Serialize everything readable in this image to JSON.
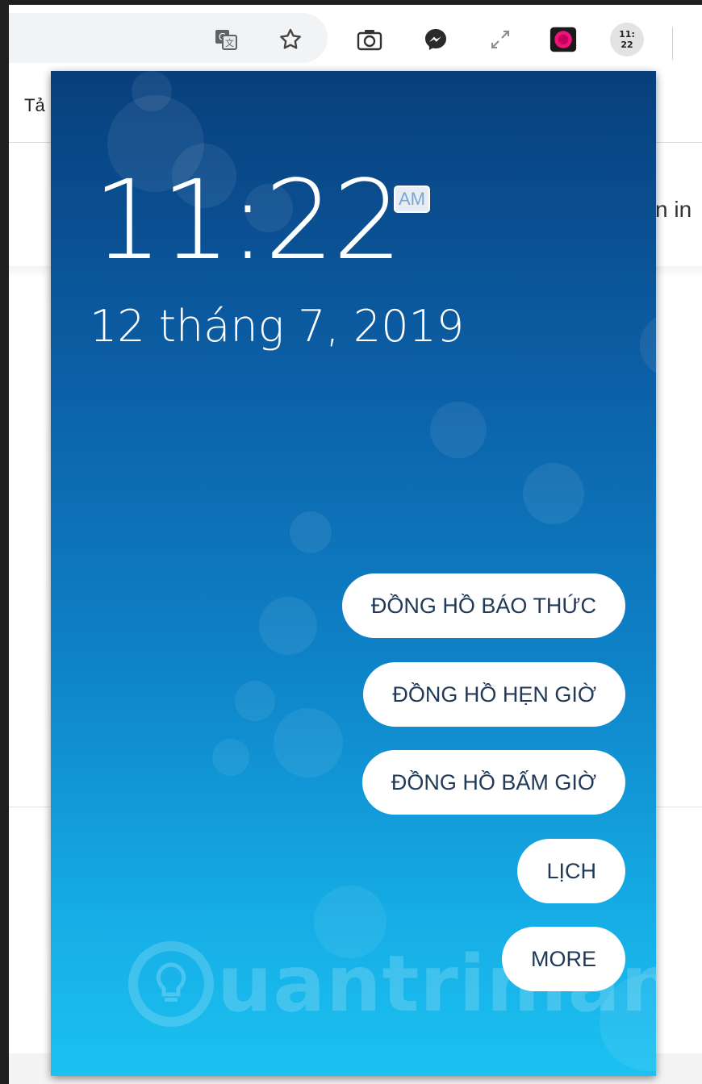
{
  "browser": {
    "toolbar_icons": [
      "translate-icon",
      "star-icon",
      "camera-icon",
      "messenger-icon",
      "expand-icon",
      "record-icon"
    ],
    "clock_extension_label": "11:\n22"
  },
  "page": {
    "left_text": "Tả",
    "right_text": "n in"
  },
  "popup": {
    "time": "11:22",
    "ampm": "AM",
    "date": "12 tháng 7, 2019",
    "buttons": [
      {
        "label": "ĐỒNG HỒ BÁO THỨC"
      },
      {
        "label": "ĐỒNG HỒ HẸN GIỜ"
      },
      {
        "label": "ĐỒNG HỒ BẤM GIỜ"
      },
      {
        "label": "LỊCH"
      },
      {
        "label": "MORE"
      }
    ],
    "watermark": "uantrimang",
    "colors": {
      "gradient_top": "#083f7c",
      "gradient_bottom": "#1cc1f1",
      "pill_text": "#203a57"
    }
  }
}
